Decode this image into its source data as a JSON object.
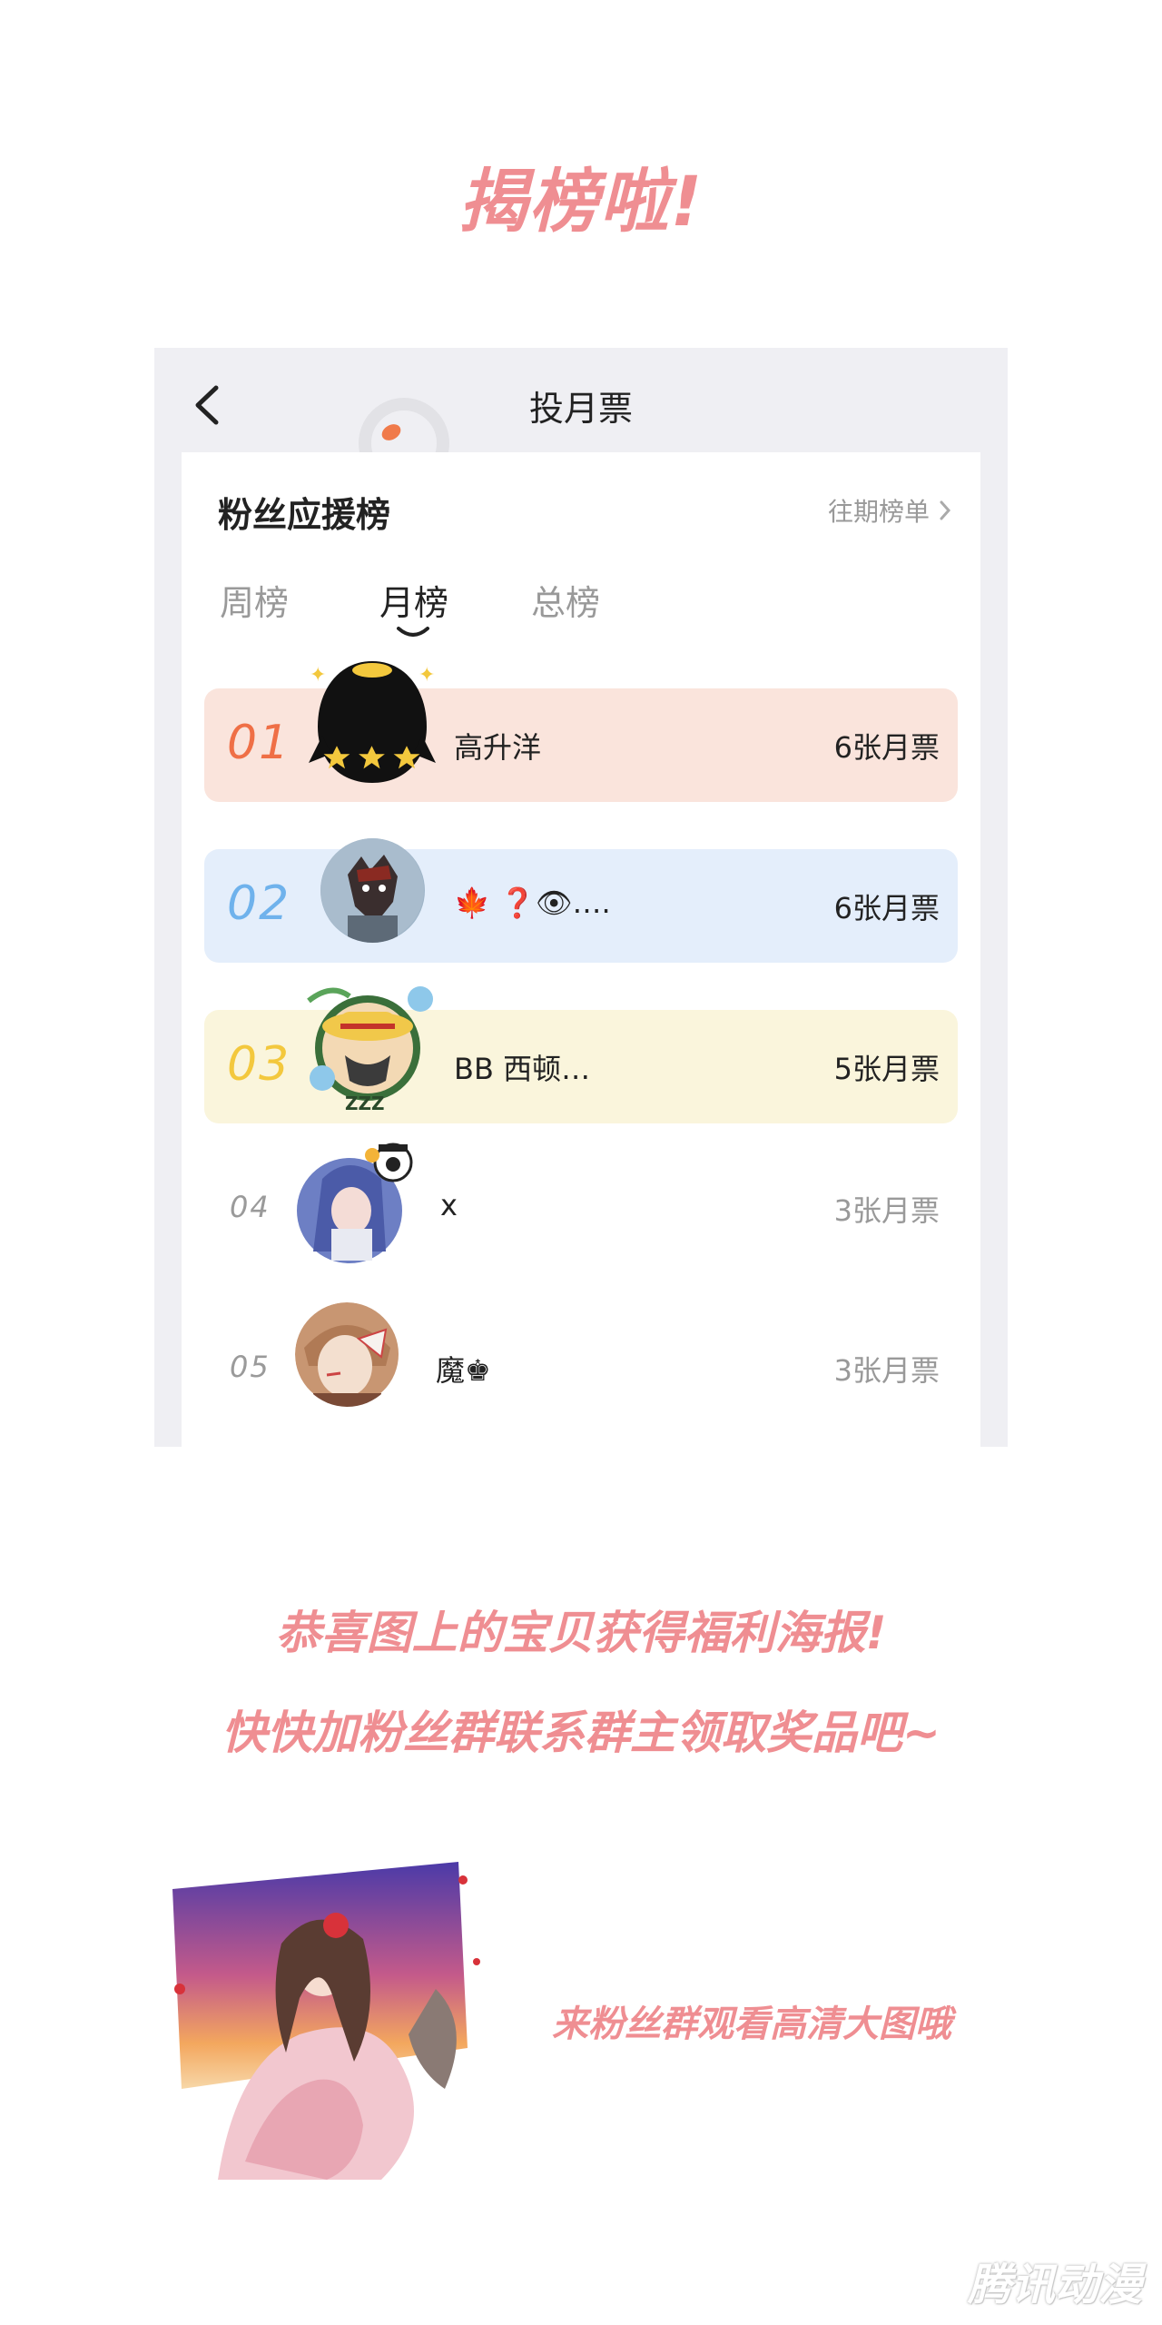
{
  "headline": "揭榜啦!",
  "phone": {
    "nav_title": "投月票",
    "card_title": "粉丝应援榜",
    "history_link": "往期榜单",
    "tabs": [
      {
        "label": "周榜",
        "active": false
      },
      {
        "label": "月榜",
        "active": true
      },
      {
        "label": "总榜",
        "active": false
      }
    ],
    "ranks": [
      {
        "rank": "01",
        "name": "高升洋",
        "votes": "6张月票",
        "bg": "#fae4dc",
        "num_color": "#ef6f46"
      },
      {
        "rank": "02",
        "name": "🍁 ❓👁….",
        "votes": "6张月票",
        "bg": "#e4eefb",
        "num_color": "#6fb2ec"
      },
      {
        "rank": "03",
        "name": "BB 西顿…",
        "votes": "5张月票",
        "bg": "#faf5dc",
        "num_color": "#f3c83d"
      },
      {
        "rank": "04",
        "name": "x",
        "votes": "3张月票",
        "bg": "#ffffff",
        "num_color": "#9a9a9a"
      },
      {
        "rank": "05",
        "name": "魔♚",
        "votes": "3张月票",
        "bg": "#ffffff",
        "num_color": "#9a9a9a"
      }
    ]
  },
  "congrats": {
    "line1": "恭喜图上的宝贝获得福利海报!",
    "line2": "快快加粉丝群联系群主领取奖品吧~"
  },
  "poster_caption": "来粉丝群观看高清大图哦",
  "watermark": "腾讯动漫",
  "colors": {
    "accent_pink": "#ef8e92"
  }
}
